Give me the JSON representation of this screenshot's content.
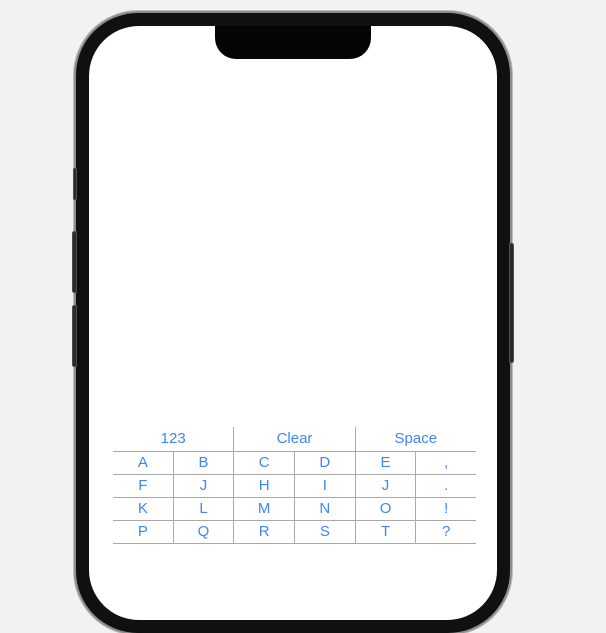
{
  "device": {
    "name": "iphone-mockup",
    "background_color": "#f2f2f2",
    "frame_color": "#101010",
    "screen_color": "#ffffff",
    "buttons": [
      {
        "name": "mute-switch"
      },
      {
        "name": "volume-up-button"
      },
      {
        "name": "volume-down-button"
      },
      {
        "name": "power-button"
      }
    ]
  },
  "keyboard": {
    "accent_color": "#3f86f7",
    "grid_line_color": "#a9a9a9",
    "header_keys": [
      {
        "label": "123"
      },
      {
        "label": "Clear"
      },
      {
        "label": "Space"
      }
    ],
    "rows": [
      {
        "keys": [
          "A",
          "B",
          "C",
          "D",
          "E",
          ","
        ]
      },
      {
        "keys": [
          "F",
          "J",
          "H",
          "I",
          "J",
          "."
        ]
      },
      {
        "keys": [
          "K",
          "L",
          "M",
          "N",
          "O",
          "!"
        ]
      },
      {
        "keys": [
          "P",
          "Q",
          "R",
          "S",
          "T",
          "?"
        ]
      }
    ]
  }
}
